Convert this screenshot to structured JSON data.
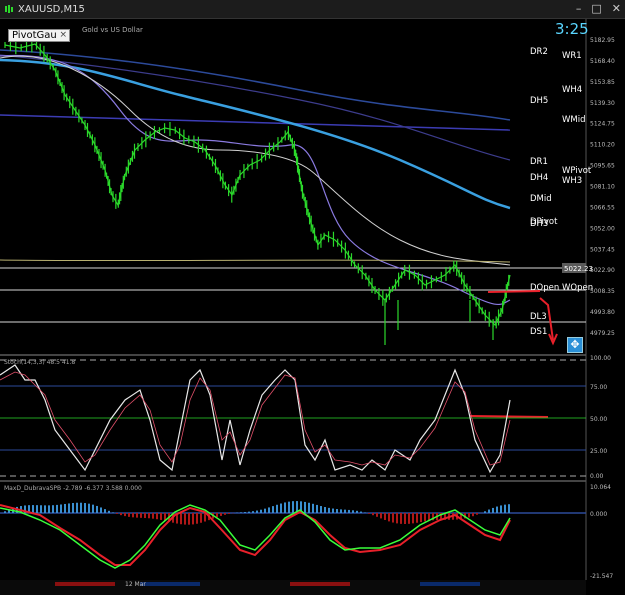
{
  "window": {
    "title": "XAUUSD,M15",
    "clock": "3:25",
    "symbol_desc": "Gold vs US Dollar"
  },
  "indicator_button": {
    "label": "PivotGau",
    "close_glyph": "×"
  },
  "pivot_labels": [
    "DR2",
    "WR1",
    "WH4",
    "DH5",
    "WMid",
    "DR1",
    "WPivot",
    "DH4",
    "WH3",
    "DMid",
    "DPivot",
    "DH3",
    "DOpen",
    "WOpen",
    "DL3",
    "DS1"
  ],
  "price_axis": [
    "5182.95",
    "5168.40",
    "5153.85",
    "5139.30",
    "5124.75",
    "5110.20",
    "5095.65",
    "5081.10",
    "5066.55",
    "5052.00",
    "5037.45",
    "5022.90",
    "5008.35",
    "4993.80",
    "4979.25"
  ],
  "current_price": "5022.23",
  "stoch_panel": {
    "header": "Stoch(14,3,3) 48.5 41.8",
    "axis": [
      "100.00",
      "75.00",
      "50.00",
      "25.00",
      "0.00"
    ]
  },
  "macd_panel": {
    "header": "MaxD_DubravaSPB -2.789 -6.377 3.588 0.000",
    "axis": [
      "10.064",
      "0.000",
      "-21.547"
    ]
  },
  "time_axis": {
    "label": "12 Mar"
  },
  "colors": {
    "candle": "#2bd92b",
    "ma_blue": "#3aa0e0",
    "ma_purple": "#8a7ae0",
    "ma_white": "#d0d0d0",
    "red": "#e8202a",
    "green": "#39ff3a",
    "clock": "#5ad6ff"
  }
}
